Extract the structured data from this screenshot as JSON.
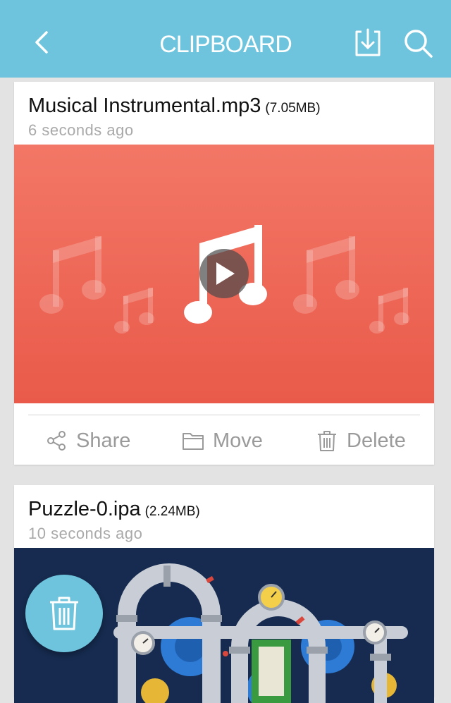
{
  "header": {
    "title": "CLIPBOARD",
    "back_icon": "chevron-left-icon",
    "download_icon": "download-tray-icon",
    "search_icon": "search-icon",
    "background_color": "#6ec4dd"
  },
  "cards": [
    {
      "file_name": "Musical Instrumental.mp3",
      "file_size": "(7.05MB)",
      "time_ago": "6 seconds ago",
      "preview": "music-notes-preview",
      "preview_color": "#ee6a59",
      "actions": {
        "share_label": "Share",
        "move_label": "Move",
        "delete_label": "Delete"
      }
    },
    {
      "file_name": "Puzzle-0.ipa",
      "file_size": "(2.24MB)",
      "time_ago": "10 seconds ago",
      "preview": "pipes-gears-illustration",
      "preview_color": "#162b4f"
    }
  ],
  "fab": {
    "icon": "trash-icon",
    "color": "#6ec4dd"
  }
}
